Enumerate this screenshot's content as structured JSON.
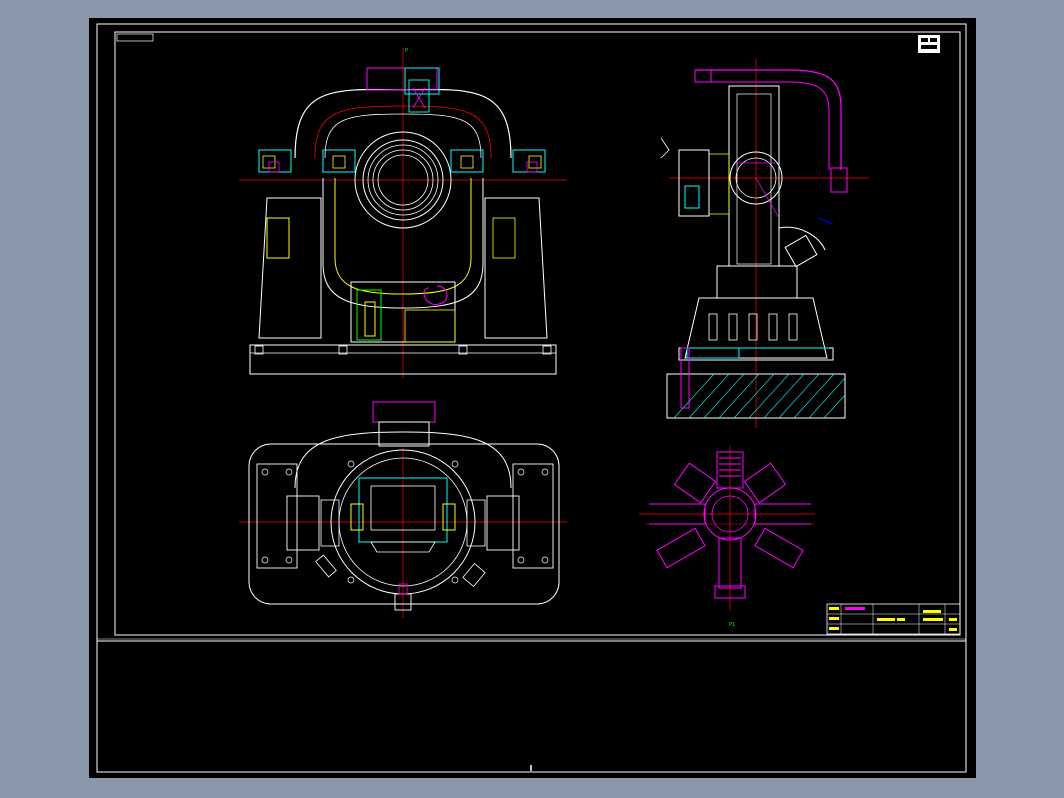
{
  "drawing": {
    "background": "#000000",
    "canvas_bg": "#8b97ab",
    "colors": {
      "outline": "#ffffff",
      "center_line": "#ff0000",
      "part_magenta": "#ff00ff",
      "part_cyan": "#00ffff",
      "part_yellow": "#ffff00",
      "part_green": "#00ff00",
      "part_blue": "#0000ff"
    },
    "view_labels": {
      "front_top": "P",
      "bottom_right": "P1"
    },
    "icons": [
      "stamp-icon",
      "crosshair-icon"
    ]
  }
}
